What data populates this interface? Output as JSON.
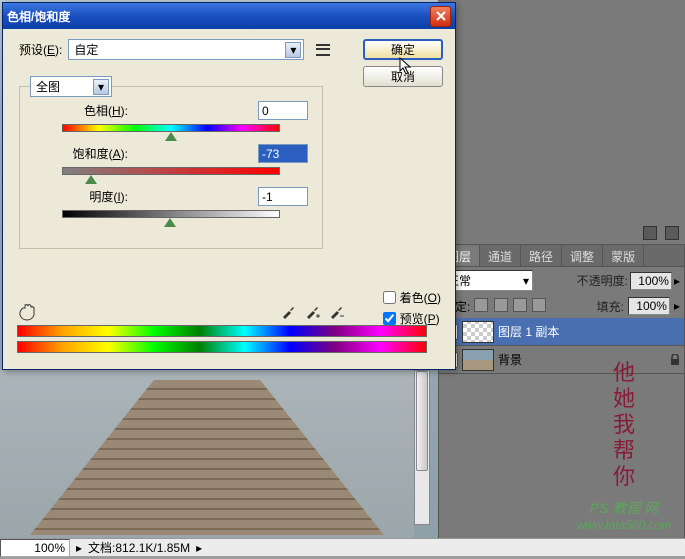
{
  "dialog": {
    "title": "色相/饱和度",
    "preset_label": "预设(E):",
    "preset_value": "自定",
    "edit_value": "全图",
    "hue_label": "色相(H):",
    "hue_value": "0",
    "sat_label": "饱和度(A):",
    "sat_value": "-73",
    "light_label": "明度(I):",
    "light_value": "-1",
    "colorize_label": "着色(O)",
    "preview_label": "预览(P)",
    "ok_label": "确定",
    "cancel_label": "取消",
    "hue_thumb_pct": 50,
    "sat_thumb_pct": 13.5,
    "light_thumb_pct": 49.5,
    "colorize_checked": false,
    "preview_checked": true
  },
  "chart_data": {
    "type": "sliders",
    "title": "色相/饱和度",
    "series": [
      {
        "name": "色相",
        "value": 0,
        "range": [
          -180,
          180
        ]
      },
      {
        "name": "饱和度",
        "value": -73,
        "range": [
          -100,
          100
        ]
      },
      {
        "name": "明度",
        "value": -1,
        "range": [
          -100,
          100
        ]
      }
    ]
  },
  "layers_panel": {
    "tabs": [
      "图层",
      "通道",
      "路径",
      "调整",
      "蒙版"
    ],
    "active_tab": 0,
    "blend_mode": "正常",
    "opacity_label": "不透明度:",
    "opacity_value": "100%",
    "lock_label": "锁定:",
    "fill_label": "填充:",
    "fill_value": "100%",
    "layers": [
      {
        "name": "图层 1 副本",
        "selected": true,
        "thumb": "checker"
      },
      {
        "name": "背景",
        "selected": false,
        "thumb": "bg",
        "locked": true
      }
    ]
  },
  "status": {
    "zoom": "100%",
    "doc_label": "文档:",
    "doc_size": "812.1K/1.85M"
  },
  "watermark": {
    "line1": "他",
    "line2": "她",
    "line3": "我",
    "line4": "帮",
    "line5": "你",
    "brand": "PS 教程 网",
    "url": "www.tata580.com"
  }
}
